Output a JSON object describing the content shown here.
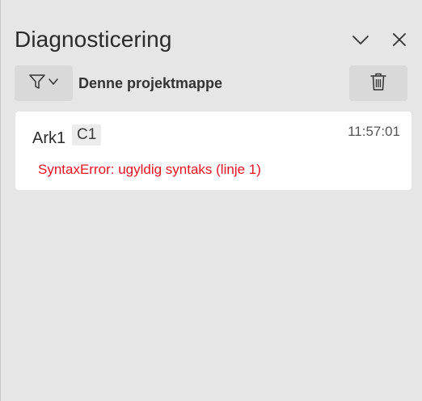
{
  "pane": {
    "title": "Diagnosticering",
    "collapse_icon": "chevron-down-icon",
    "close_icon": "close-icon"
  },
  "toolbar": {
    "filter_icon": "filter-icon",
    "scope_label": "Denne projektmappe",
    "clear_icon": "trash-icon"
  },
  "entries": [
    {
      "sheet": "Ark1",
      "cell": "C1",
      "time": "11:57:01",
      "message": "SyntaxError: ugyldig syntaks (linje 1)"
    }
  ],
  "colors": {
    "background": "#e6e6e6",
    "card": "#ffffff",
    "button": "#d9d9d9",
    "error": "#e81123"
  }
}
